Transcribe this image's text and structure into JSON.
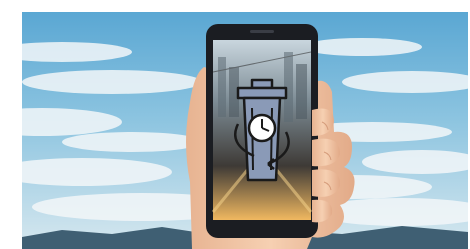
{
  "image": {
    "subject": "hand-holding-smartphone-with-timelapse-icon",
    "icon": "trash-bin-clock-icon",
    "colors": {
      "sky_top": "#6fb4d9",
      "sky_mid": "#8cc4e0",
      "sky_low": "#c9e1ec",
      "cloud": "#f2f6f8",
      "hills": "#3f5f73",
      "phone_body": "#1b1d22",
      "skin": "#f2c7a4",
      "skin_shadow": "#d9a383",
      "icon_fill": "#8a9ab7",
      "icon_stroke": "#1a1a1a",
      "screen_light": "#f4c06a"
    }
  }
}
